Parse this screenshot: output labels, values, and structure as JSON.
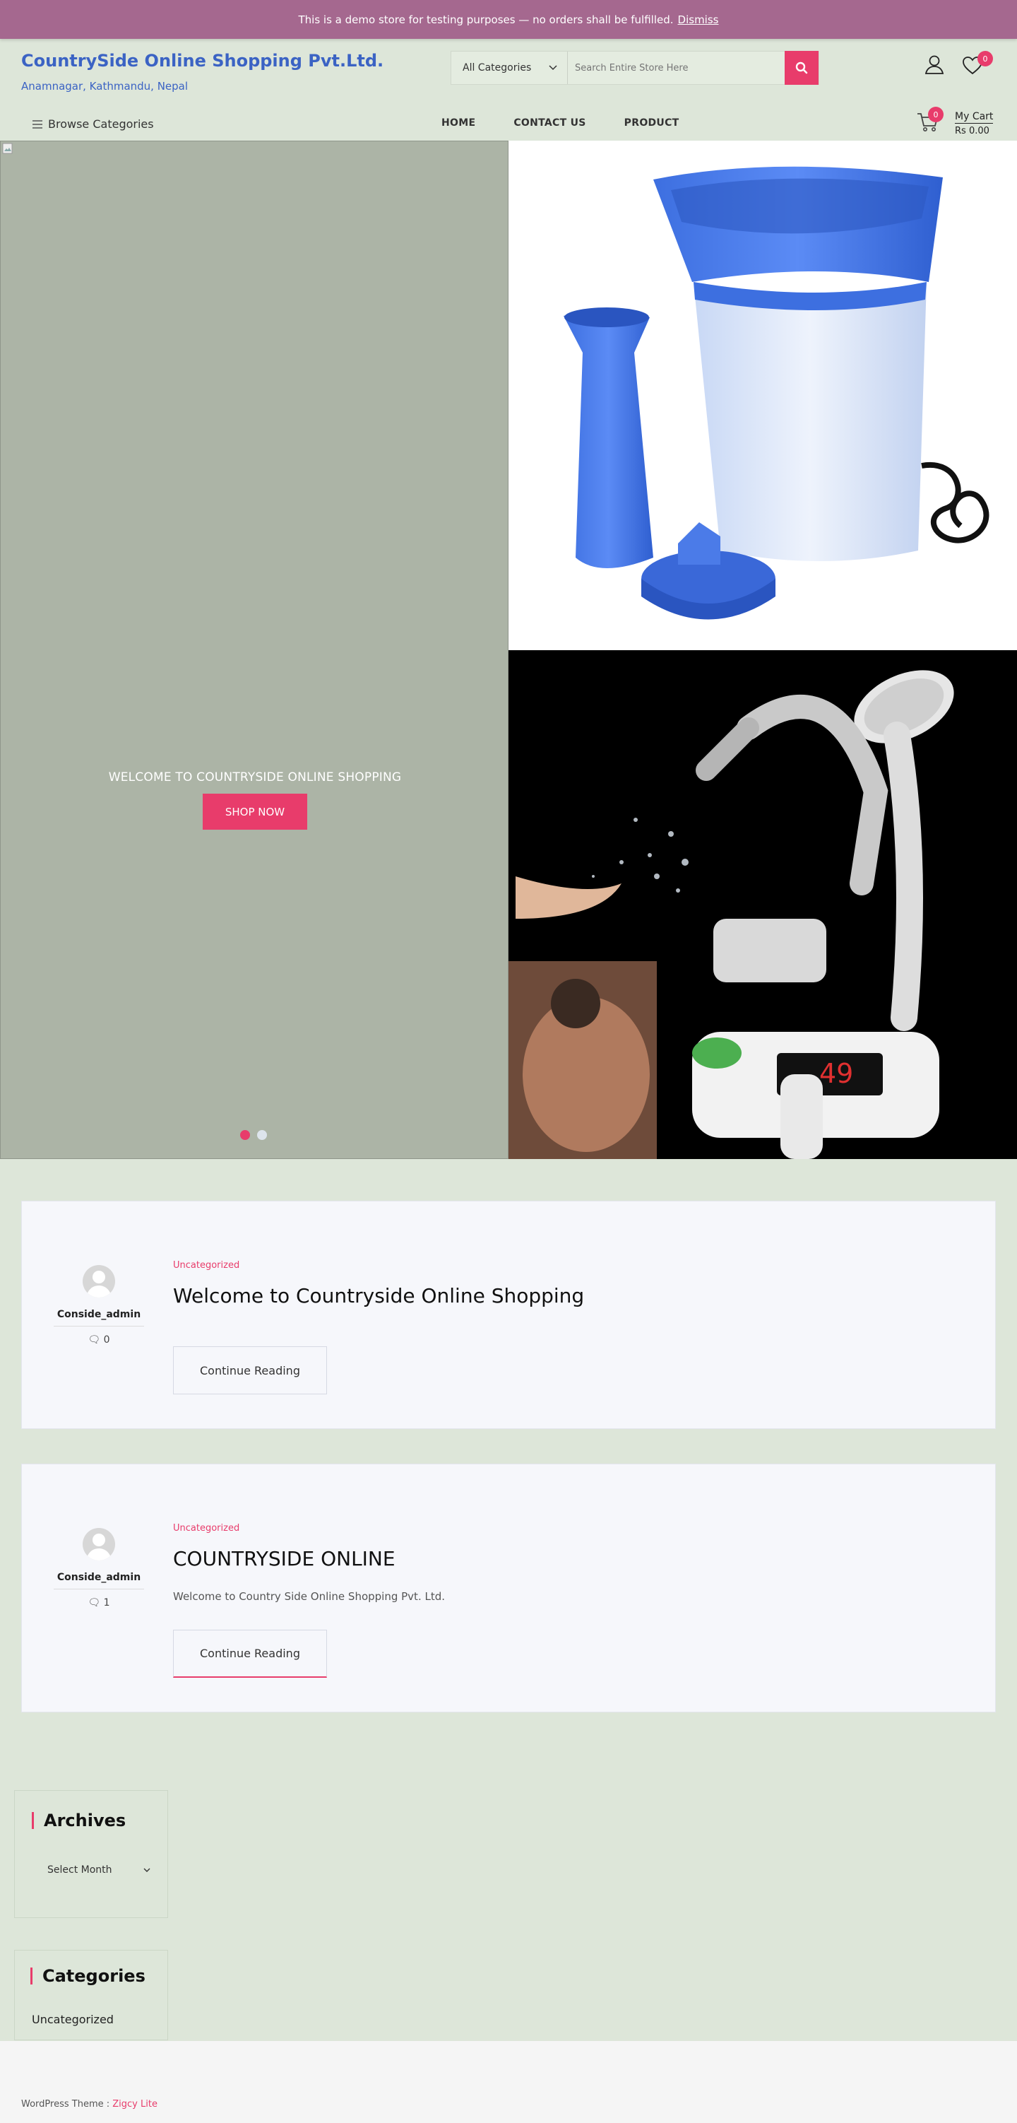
{
  "demo_notice": {
    "text": "This is a demo store for testing purposes — no orders shall be fulfilled.",
    "dismiss_label": "Dismiss"
  },
  "site": {
    "title": "CountrySide Online Shopping Pvt.Ltd.",
    "description": "Anamnagar, Kathmandu, Nepal"
  },
  "search": {
    "category_selected": "All Categories",
    "placeholder": "Search Entire Store Here"
  },
  "header": {
    "wishlist_count": "0",
    "cart_count": "0",
    "cart_label": "My Cart",
    "cart_total": "Rs 0.00"
  },
  "nav": {
    "browse_label": "Browse Categories",
    "items": [
      "HOME",
      "CONTACT US",
      "PRODUCT"
    ]
  },
  "hero": {
    "caption": "WELCOME TO COUNTRYSIDE ONLINE SHOPPING",
    "button_label": "SHOP NOW",
    "slides": 2,
    "active_slide": 1
  },
  "posts": [
    {
      "author": "Conside_admin",
      "comments": "0",
      "category": "Uncategorized",
      "title": "Welcome to Countryside Online Shopping",
      "excerpt": "",
      "button_label": "Continue Reading"
    },
    {
      "author": "Conside_admin",
      "comments": "1",
      "category": "Uncategorized",
      "title": "COUNTRYSIDE ONLINE",
      "excerpt": "Welcome to Country Side Online Shopping Pvt. Ltd.",
      "button_label": "Continue Reading"
    }
  ],
  "sidebar": {
    "archives_title": "Archives",
    "archives_select": "Select Month",
    "categories_title": "Categories",
    "categories": [
      "Uncategorized"
    ]
  },
  "footer": {
    "prefix": "WordPress Theme : ",
    "theme_link": "Zigcy Lite"
  },
  "colors": {
    "accent": "#e83c6b",
    "brand": "#3b63c4",
    "page_bg": "#dde6d9",
    "demo_bar": "#a5688f"
  }
}
